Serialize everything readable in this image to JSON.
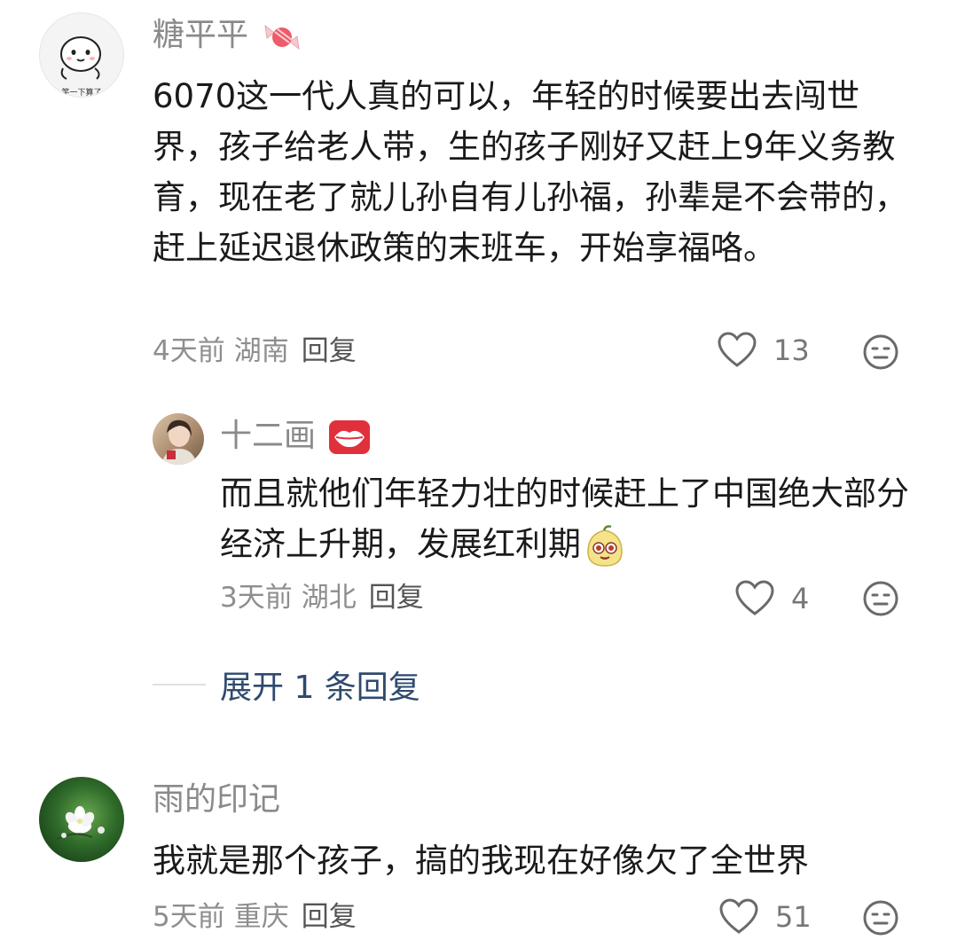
{
  "comments": [
    {
      "username": "糖平平",
      "avatar_caption": "笑一下算了",
      "text": "6070这一代人真的可以，年轻的时候要出去闯世界，孩子给老人带，生的孩子刚好又赶上9年义务教育，现在老了就儿孙自有儿孙福，孙辈是不会带的，赶上延迟退休政策的末班车，开始享福咯。",
      "time": "4天前",
      "region": "湖南",
      "reply_label": "回复",
      "likes": "13",
      "badge_icon": "candy-icon",
      "reply": {
        "username": "十二画",
        "text": "而且就他们年轻力壮的时候赶上了中国绝大部分经济上升期，发展红利期",
        "time": "3天前",
        "region": "湖北",
        "reply_label": "回复",
        "likes": "4",
        "badge_icon": "lips-icon",
        "inline_emoji": "pear-smile-emoji"
      },
      "expand_label": "展开 1 条回复"
    },
    {
      "username": "雨的印记",
      "text": "我就是那个孩子，搞的我现在好像欠了全世界",
      "time": "5天前",
      "region": "重庆",
      "reply_label": "回复",
      "likes": "51"
    }
  ],
  "colors": {
    "username": "#8a8a8a",
    "meta": "#8e8e8e",
    "expand_link": "#2f4a6e",
    "lips": "#e0303c"
  }
}
